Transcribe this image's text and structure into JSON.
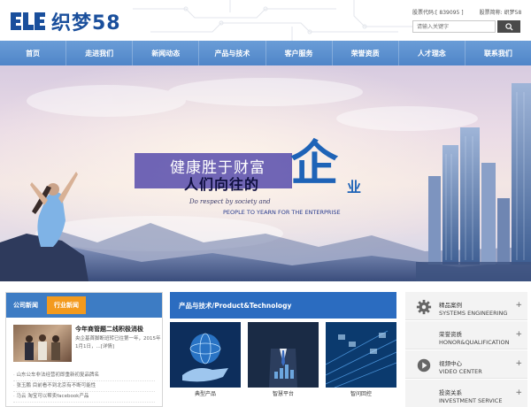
{
  "header": {
    "logo_text": "织梦58",
    "stock_code_label": "股票代码:[",
    "stock_code_value": "839095",
    "stock_code_end": "]",
    "stock_abbr_label": "股票简称:",
    "stock_abbr_value": "织梦58",
    "search_placeholder": "请输入关键字"
  },
  "nav": {
    "items": [
      "首页",
      "走进我们",
      "新闻动态",
      "产品与技术",
      "客户服务",
      "荣誉资质",
      "人才理念",
      "联系我们"
    ]
  },
  "banner": {
    "line1": "健康胜于财富",
    "line2": "人们向往的",
    "big_char": "企",
    "small_char": "业",
    "en_line1": "Do respect by society and",
    "en_line2": "PEOPLE TO YEARN FOR THE ENTERPRISE"
  },
  "news": {
    "tab_company": "公司新闻",
    "tab_industry": "行业新闻",
    "featured_title": "今年商管题二线积极消极",
    "featured_desc": "央企基首脚断班转已往第一年，2015年1月1日，...[详情]",
    "list": [
      "山东公车非法经营初即重新初复品牌名",
      "张玉鹏 目前看不到北京有不断可能性",
      "马云 淘宝可以帮卖facebook产品"
    ]
  },
  "products": {
    "heading": "产品与技术/Product&Technology",
    "items": [
      "典型产品",
      "智慧平台",
      "智问回控"
    ]
  },
  "sidebar": {
    "items": [
      {
        "cn": "精品案例",
        "en": "SYSTEMS ENGINEERING",
        "icon": "gear-icon"
      },
      {
        "cn": "荣誉资质",
        "en": "HONOR&QUALIFICATION",
        "icon": "certificate-icon"
      },
      {
        "cn": "视频中心",
        "en": "VIDEO CENTER",
        "icon": "play-icon"
      },
      {
        "cn": "投资关系",
        "en": "INVESTMENT SERVICE",
        "icon": "group-icon"
      }
    ]
  },
  "colors": {
    "brand": "#1a4f9c",
    "nav": "#4f85c8",
    "accent_orange": "#f39a1e",
    "section_blue": "#2b6cc0"
  }
}
